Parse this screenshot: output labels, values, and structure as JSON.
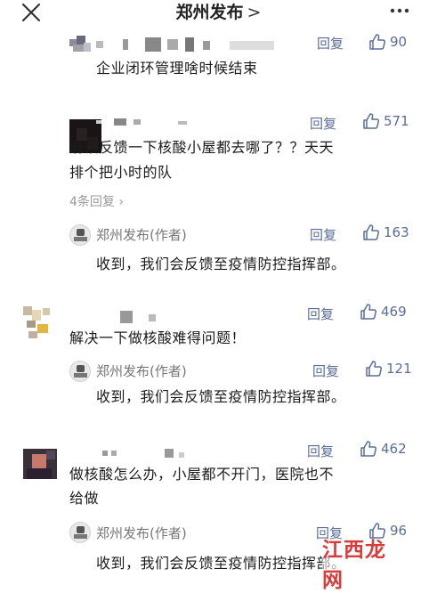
{
  "nav": {
    "title": "郑州发布",
    "chevron": ">"
  },
  "colors": {
    "link": "#5a6e99",
    "muted": "#9a9a9a",
    "text": "#1b1b1b"
  },
  "comments": [
    {
      "text_lines": [
        "企业闭环管理啥时候结束"
      ],
      "reply_label": "回复",
      "likes": "90"
    },
    {
      "text_lines": [
        "麻烦反馈一下核酸小屋都去哪了？？天天",
        "排个把小时的队"
      ],
      "reply_label": "回复",
      "likes": "571",
      "replies_count": "4条回复",
      "author_reply": {
        "name": "郑州发布(作者)",
        "reply_label": "回复",
        "likes": "163",
        "text": "收到，我们会反馈至疫情防控指挥部。"
      }
    },
    {
      "text_lines": [
        "解决一下做核酸难得问题！"
      ],
      "reply_label": "回复",
      "likes": "469",
      "author_reply": {
        "name": "郑州发布(作者)",
        "reply_label": "回复",
        "likes": "121",
        "text": "收到，我们会反馈至疫情防控指挥部。"
      }
    },
    {
      "text_lines": [
        "做核酸怎么办，小屋都不开门，医院也不",
        "给做"
      ],
      "reply_label": "回复",
      "likes": "462",
      "author_reply": {
        "name": "郑州发布(作者)",
        "reply_label": "回复",
        "likes": "96",
        "text": "收到，我们会反馈至疫情防控指挥部。"
      }
    }
  ],
  "watermark": "江西龙网",
  "icons": {
    "close": "close-icon",
    "more": "more-icon",
    "like": "thumbs-up-icon",
    "expand": "chevron-right-icon"
  }
}
